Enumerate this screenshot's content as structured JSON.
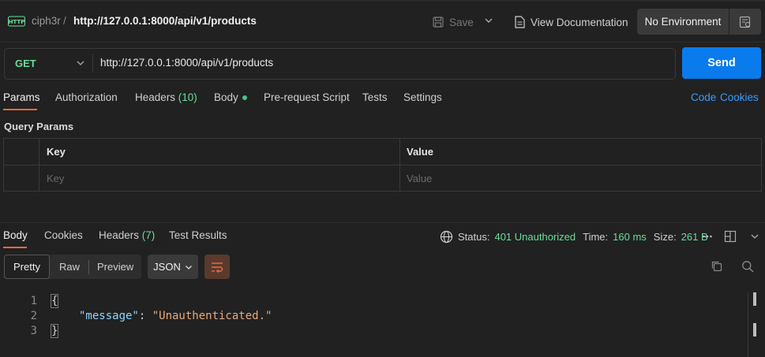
{
  "header": {
    "workspace": "ciph3r",
    "separator": "/",
    "request_url": "http://127.0.0.1:8000/api/v1/products",
    "save_label": "Save",
    "view_doc_label": "View Documentation",
    "environment": "No Environment"
  },
  "request": {
    "method": "GET",
    "url": "http://127.0.0.1:8000/api/v1/products",
    "send_label": "Send",
    "tabs": {
      "params": "Params",
      "authorization": "Authorization",
      "headers": "Headers",
      "headers_count": "(10)",
      "body": "Body",
      "prerequest": "Pre-request Script",
      "tests": "Tests",
      "settings": "Settings"
    },
    "code_link": "Code",
    "cookies_link": "Cookies"
  },
  "query_params": {
    "title": "Query Params",
    "col_key": "Key",
    "col_value": "Value",
    "key_placeholder": "Key",
    "value_placeholder": "Value"
  },
  "response": {
    "tabs": {
      "body": "Body",
      "cookies": "Cookies",
      "headers": "Headers",
      "headers_count": "(7)",
      "test_results": "Test Results"
    },
    "status_label": "Status:",
    "status_value": "401 Unauthorized",
    "time_label": "Time:",
    "time_value": "160 ms",
    "size_label": "Size:",
    "size_value": "261 B",
    "view_modes": {
      "pretty": "Pretty",
      "raw": "Raw",
      "preview": "Preview"
    },
    "format": "JSON",
    "lines": [
      {
        "n": "1",
        "open": "{"
      },
      {
        "n": "2",
        "key": "\"message\"",
        "colon": ": ",
        "value": "\"Unauthenticated.\""
      },
      {
        "n": "3",
        "close": "}"
      }
    ]
  },
  "colors": {
    "accent_orange": "#f26b3a",
    "send_blue": "#097bed",
    "method_green": "#6bdd9a",
    "link_blue": "#3a9bff"
  }
}
